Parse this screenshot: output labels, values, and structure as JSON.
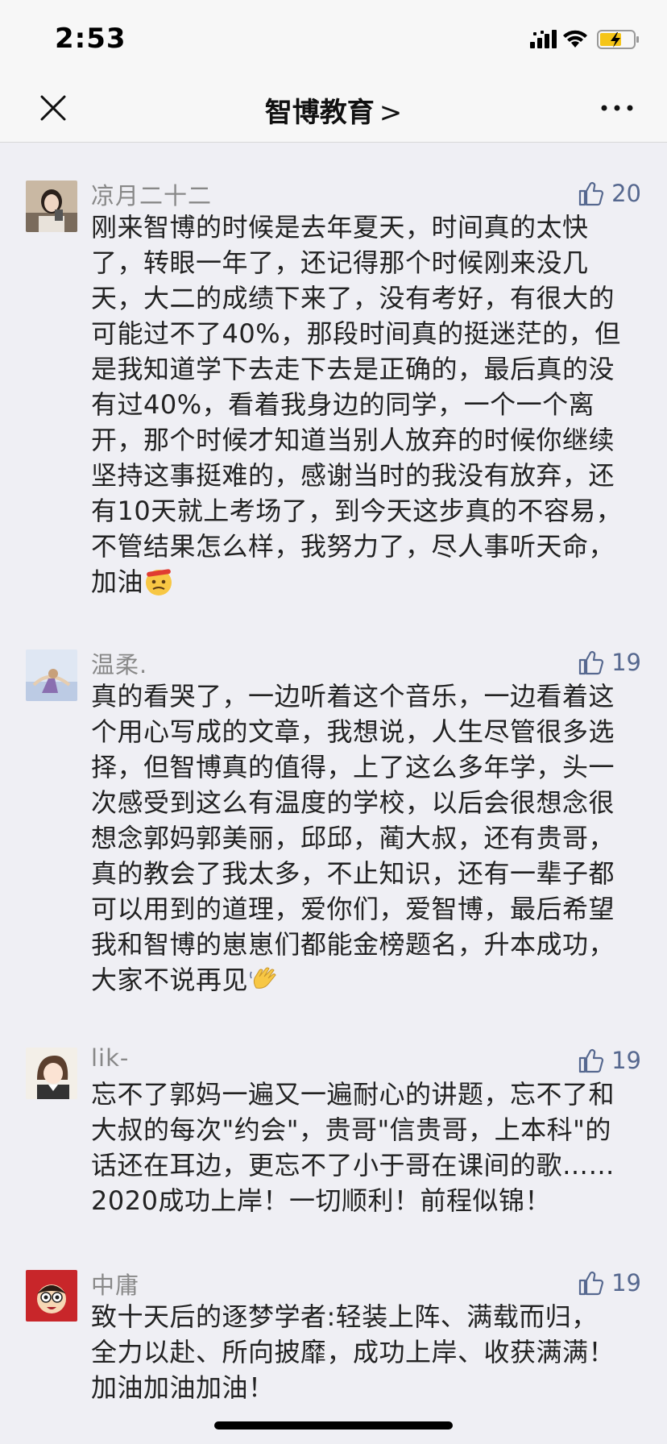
{
  "status": {
    "time": "2:53"
  },
  "nav": {
    "title": "智博教育",
    "chevron": ">"
  },
  "comments": [
    {
      "nickname": "凉月二十二",
      "likes": "20",
      "avatar_icon": "girl-photo-avatar",
      "text": "刚来智博的时候是去年夏天，时间真的太快\n了，转眼一年了，还记得那个时候刚来没几\n天，大二的成绩下来了，没有考好，有很大的\n可能过不了40%，那段时间真的挺迷茫的，但\n是我知道学下去走下去是正确的，最后真的没\n有过40%，看着我身边的同学，一个一个离\n开，那个时候才知道当别人放弃的时候你继续\n坚持这事挺难的，感谢当时的我没有放弃，还\n有10天就上考场了，到今天这步真的不容易，\n不管结果怎么样，我努力了，尽人事听天命，\n加油",
      "emoji": "determined-face-emoji"
    },
    {
      "nickname": "温柔.",
      "likes": "19",
      "avatar_icon": "illustrated-girl-avatar",
      "text": "真的看哭了，一边听着这个音乐，一边看着这\n个用心写成的文章，我想说，人生尽管很多选\n择，但智博真的值得，上了这么多年学，头一\n次感受到这么有温度的学校，以后会很想念很\n想念郭妈郭美丽，邱邱，蔺大叔，还有贵哥，\n真的教会了我太多，不止知识，还有一辈子都\n可以用到的道理，爱你们，爱智博，最后希望\n我和智博的崽崽们都能金榜题名，升本成功，\n大家不说再见",
      "emoji": "waving-hand-emoji"
    },
    {
      "nickname": "lik-",
      "likes": "19",
      "avatar_icon": "cartoon-student-avatar",
      "text": "忘不了郭妈一遍又一遍耐心的讲题，忘不了和\n大叔的每次\"约会\"，贵哥\"信贵哥，上本科\"的\n话还在耳边，更忘不了小于哥在课间的歌……\n2020成功上岸！一切顺利！前程似锦！"
    },
    {
      "nickname": "中庸",
      "likes": "19",
      "avatar_icon": "cartoon-face-avatar",
      "text": "致十天后的逐梦学者:轻装上阵、满载而归，\n全力以赴、所向披靡，成功上岸、收获满满！\n加油加油加油！"
    }
  ],
  "colors": {
    "background": "#efeff4",
    "like_blue": "#56688f",
    "nickname_gray": "#888888"
  }
}
